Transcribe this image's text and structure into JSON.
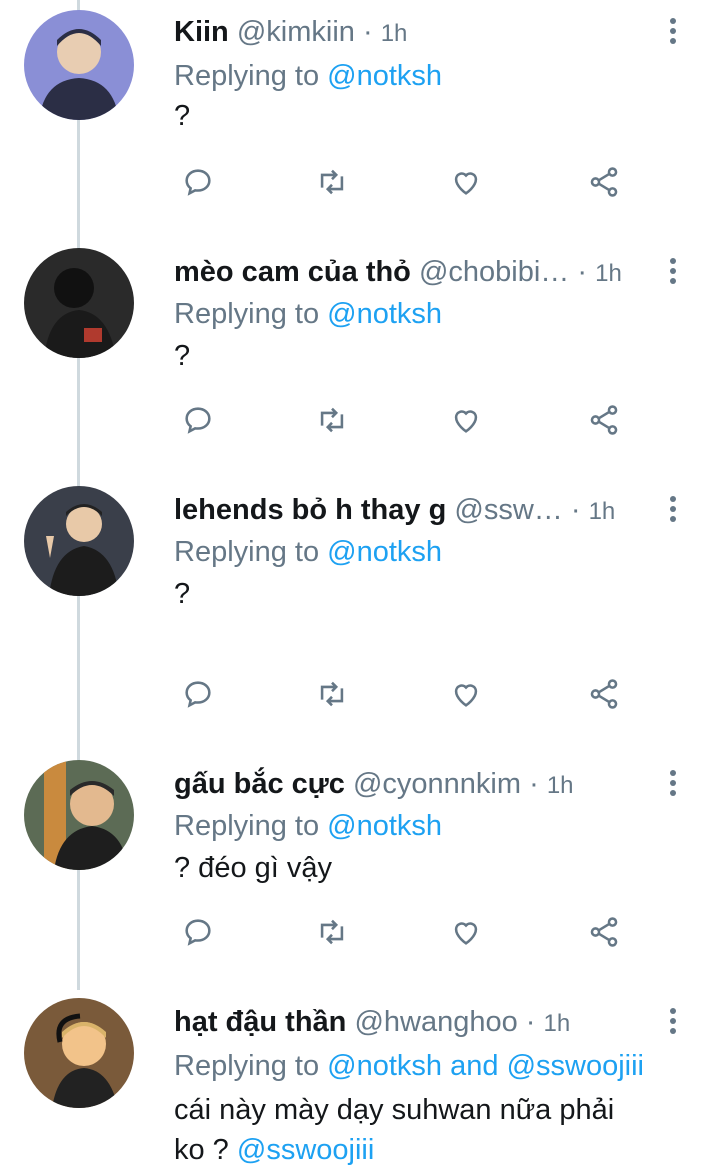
{
  "replying_label": "Replying to",
  "tweets": [
    {
      "name": "Kiin",
      "handle": "@kimkiin",
      "dot": "·",
      "time": "1h",
      "reply_to": "@notksh",
      "text": "?",
      "avatar_colors": {
        "bg": "#8a8fd6",
        "fg": "#2b2e45"
      }
    },
    {
      "name": "mèo cam của thỏ",
      "handle": "@chobibi…",
      "dot": "·",
      "time": "1h",
      "reply_to": "@notksh",
      "text": "?",
      "avatar_colors": {
        "bg": "#2a2a2a",
        "fg": "#b03a2e"
      }
    },
    {
      "name": "lehends bỏ h thay g",
      "handle": "@ssw…",
      "dot": "·",
      "time": "1h",
      "reply_to": "@notksh",
      "text": "?",
      "avatar_colors": {
        "bg": "#3a3f4a",
        "fg": "#e8c9a8"
      }
    },
    {
      "name": "gấu bắc cực",
      "handle": "@cyonnnkim",
      "dot": "·",
      "time": "1h",
      "reply_to": "@notksh",
      "text": "? đéo gì vậy",
      "avatar_colors": {
        "bg": "#5c6b55",
        "fg": "#e3b98f"
      }
    },
    {
      "name": "hạt đậu thần",
      "handle": "@hwanghoo",
      "dot": "·",
      "time": "1h",
      "reply_to": "@notksh",
      "reply_and": "and",
      "reply_to_2": "@sswoojiii",
      "text_line1": "cái này mày dạy suhwan nữa phải",
      "text_line2_prefix": "ko ?",
      "text_line2_mention": "@sswoojiii",
      "avatar_colors": {
        "bg": "#7a5a3a",
        "fg": "#f2c38a"
      }
    }
  ],
  "icons": {
    "reply": "reply-icon",
    "retweet": "retweet-icon",
    "like": "like-icon",
    "share": "share-icon",
    "more": "more-vertical-icon"
  },
  "colors": {
    "mention": "#1da1f2",
    "secondary": "#657786",
    "primary_text": "#14171a"
  }
}
